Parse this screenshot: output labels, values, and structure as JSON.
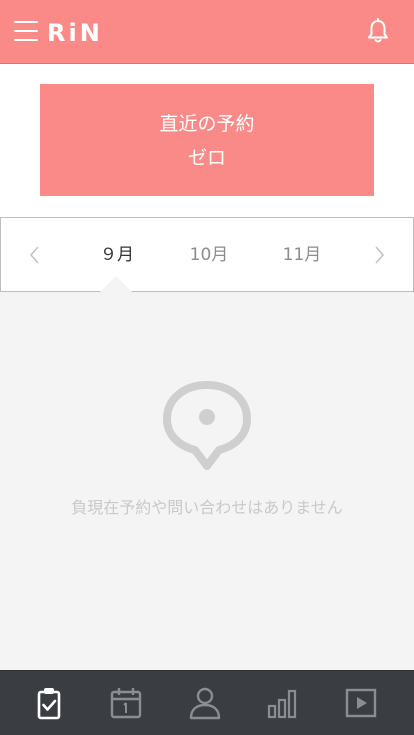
{
  "header": {
    "logo_text": "RiN",
    "brand_color": "#fa8a87",
    "menu_icon": "hamburger-menu-icon",
    "notification_icon": "bell-icon"
  },
  "upcoming": {
    "title": "直近の予約",
    "value": "ゼロ"
  },
  "month_selector": {
    "prev_icon": "chevron-left-icon",
    "next_icon": "chevron-right-icon",
    "months": [
      "９月",
      "10月",
      "11月"
    ],
    "selected_index": 0
  },
  "empty_state": {
    "icon": "speech-bubble-icon",
    "message": "負現在予約や問い合わせはありません"
  },
  "tab_bar": {
    "background": "#3a3e42",
    "active_color": "#ffffff",
    "inactive_color": "#8a8e92",
    "tabs": [
      {
        "icon": "clipboard-check-icon",
        "active": true
      },
      {
        "icon": "calendar-icon",
        "active": false
      },
      {
        "icon": "user-icon",
        "active": false
      },
      {
        "icon": "bar-chart-icon",
        "active": false
      },
      {
        "icon": "play-icon",
        "active": false
      }
    ]
  }
}
